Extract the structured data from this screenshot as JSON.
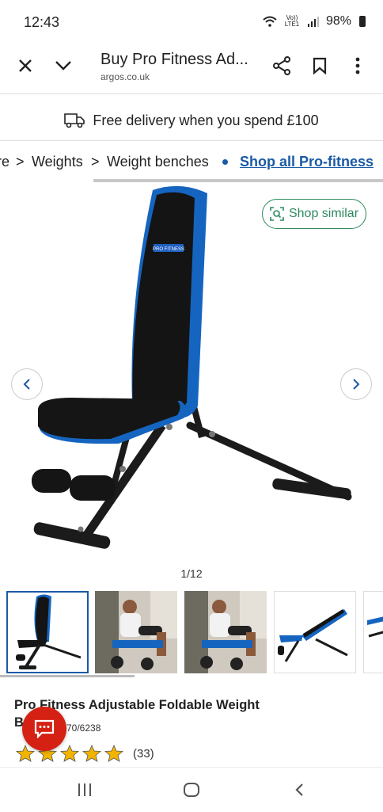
{
  "status_bar": {
    "time": "12:43",
    "lte_label": "Vo)) LTE1",
    "battery": "98%"
  },
  "browser": {
    "title": "Buy Pro Fitness Ad...",
    "url": "argos.co.uk"
  },
  "delivery_banner": {
    "text": "Free delivery when you spend £100",
    "icon": "truck-icon"
  },
  "breadcrumb": {
    "items": [
      "re",
      "Weights",
      "Weight benches"
    ],
    "separator": ">",
    "link": "Shop all Pro-fitness"
  },
  "gallery": {
    "shop_similar_label": "Shop similar",
    "counter": "1/12",
    "brand_label": "PRO FITNESS"
  },
  "product": {
    "title_line1": "Pro Fitness Adjustable Foldable Weight",
    "title_line2_start": "B",
    "catalogue_number": "70/6238",
    "rating_stars": 5,
    "review_count": "(33)"
  },
  "colors": {
    "accent_blue": "#1a5aa6",
    "bench_blue": "#1565c0",
    "green": "#2d8a5e",
    "chat_red": "#d42114",
    "star": "#f2b400"
  }
}
